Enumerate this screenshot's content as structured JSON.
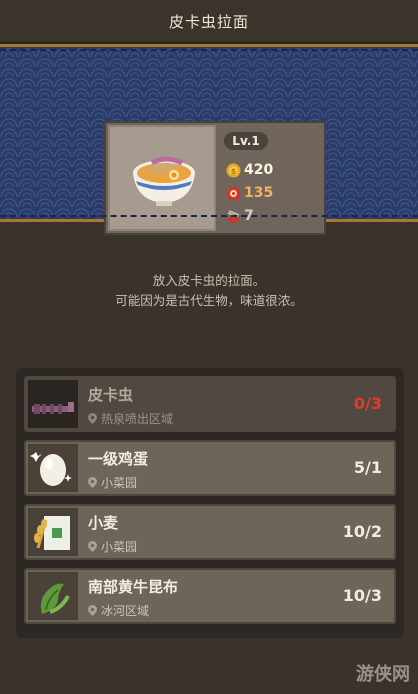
{
  "header": {
    "title": "皮卡虫拉面"
  },
  "dish": {
    "level": "Lv.1",
    "price": "420",
    "fame": "135",
    "servings": "7",
    "description_line1": "放入皮卡虫的拉面。",
    "description_line2": "可能因为是古代生物，味道很浓。"
  },
  "ingredients": [
    {
      "name": "皮卡虫",
      "location": "热泉喷出区域",
      "count": "0/3",
      "icon": "pika-bug-icon"
    },
    {
      "name": "一级鸡蛋",
      "location": "小菜园",
      "count": "5/1",
      "icon": "egg-icon"
    },
    {
      "name": "小麦",
      "location": "小菜园",
      "count": "10/2",
      "icon": "wheat-icon"
    },
    {
      "name": "南部黄牛昆布",
      "location": "冰河区域",
      "count": "10/3",
      "icon": "kelp-icon"
    }
  ],
  "colors": {
    "insufficient": "#e23a2a",
    "banner": "#2a3b6a",
    "gold_trim": "#a9782d"
  },
  "watermark": "游侠网"
}
